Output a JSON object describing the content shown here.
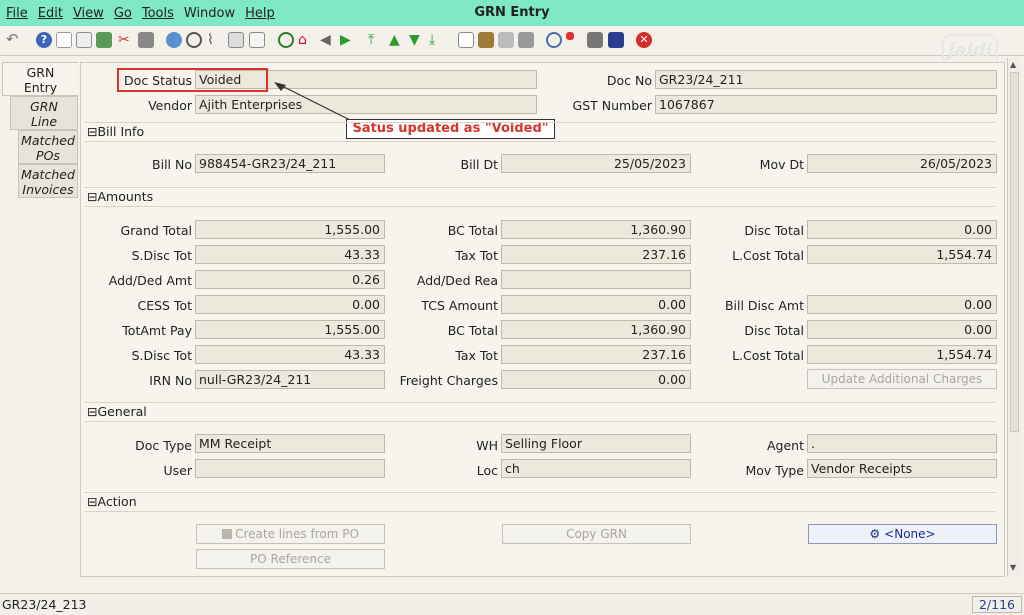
{
  "menu": {
    "items": [
      "File",
      "Edit",
      "View",
      "Go",
      "Tools",
      "Window",
      "Help"
    ],
    "title": "GRN Entry"
  },
  "logo": {
    "text": "jaldi"
  },
  "tabs": [
    {
      "label_1": "GRN",
      "label_2": "Entry"
    },
    {
      "label_1": "GRN",
      "label_2": "Line"
    },
    {
      "label_1": "Matched",
      "label_2": "POs"
    },
    {
      "label_1": "Matched",
      "label_2": "Invoices"
    }
  ],
  "header": {
    "doc_status_label": "Doc Status",
    "doc_status_value": "Voided",
    "vendor_label": "Vendor",
    "vendor_value": "Ajith Enterprises",
    "doc_no_label": "Doc No",
    "doc_no_value": "GR23/24_211",
    "gst_label": "GST Number",
    "gst_value": "1067867"
  },
  "callout": {
    "text": "Satus updated as \"Voided\"",
    "color": "#d9342b"
  },
  "sections": {
    "bill_info": "Bill Info",
    "amounts": "Amounts",
    "general": "General",
    "action": "Action",
    "toggle_symbol": "⊟"
  },
  "bill_info": {
    "bill_no_label": "Bill No",
    "bill_no_value": "988454-GR23/24_211",
    "bill_dt_label": "Bill Dt",
    "bill_dt_value": "25/05/2023",
    "mov_dt_label": "Mov Dt",
    "mov_dt_value": "26/05/2023"
  },
  "amounts": {
    "grand_total_label": "Grand Total",
    "grand_total_value": "1,555.00",
    "bc_total_label": "BC Total",
    "bc_total_value": "1,360.90",
    "disc_total_label": "Disc Total",
    "disc_total_value": "0.00",
    "sdisc_tot_label": "S.Disc Tot",
    "sdisc_tot_value": "43.33",
    "tax_tot_label": "Tax Tot",
    "tax_tot_value": "237.16",
    "lcost_total_label": "L.Cost Total",
    "lcost_total_value": "1,554.74",
    "add_ded_amt_label": "Add/Ded Amt",
    "add_ded_amt_value": "0.26",
    "add_ded_rea_label": "Add/Ded Rea",
    "add_ded_rea_value": "",
    "cess_tot_label": "CESS Tot",
    "cess_tot_value": "0.00",
    "tcs_amount_label": "TCS Amount",
    "tcs_amount_value": "0.00",
    "bill_disc_amt_label": "Bill Disc Amt",
    "bill_disc_amt_value": "0.00",
    "totamt_pay_label": "TotAmt Pay",
    "totamt_pay_value": "1,555.00",
    "bc_total2_label": "BC Total",
    "bc_total2_value": "1,360.90",
    "disc_total2_label": "Disc Total",
    "disc_total2_value": "0.00",
    "sdisc_tot2_label": "S.Disc Tot",
    "sdisc_tot2_value": "43.33",
    "tax_tot2_label": "Tax Tot",
    "tax_tot2_value": "237.16",
    "lcost_total2_label": "L.Cost Total",
    "lcost_total2_value": "1,554.74",
    "irn_no_label": "IRN No",
    "irn_no_value": "null-GR23/24_211",
    "freight_label": "Freight Charges",
    "freight_value": "0.00",
    "update_button": "Update Additional Charges"
  },
  "general": {
    "doc_type_label": "Doc Type",
    "doc_type_value": "MM Receipt",
    "wh_label": "WH",
    "wh_value": "Selling Floor",
    "agent_label": "Agent",
    "agent_value": ".",
    "user_label": "User",
    "user_value": "",
    "loc_label": "Loc",
    "loc_value": "ch",
    "mov_type_label": "Mov Type",
    "mov_type_value": "Vendor Receipts"
  },
  "action": {
    "create_lines": "Create lines from PO",
    "copy_grn": "Copy GRN",
    "none_button": "<None>",
    "po_reference": "PO Reference"
  },
  "status": {
    "left": "GR23/24_213",
    "right": "2/116"
  }
}
